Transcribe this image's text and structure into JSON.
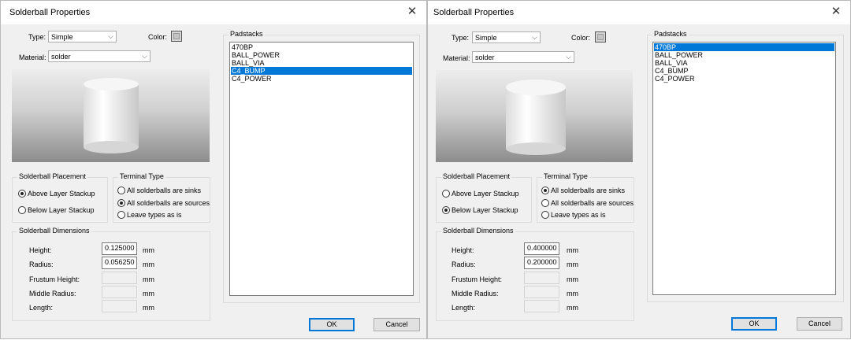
{
  "dialogs": [
    {
      "title": "Solderball Properties",
      "type_label": "Type:",
      "type_value": "Simple",
      "color_label": "Color:",
      "material_label": "Material:",
      "material_value": "solder",
      "placement": {
        "title": "Solderball Placement",
        "options": [
          "Above Layer Stackup",
          "Below Layer Stackup"
        ],
        "selected": 0
      },
      "terminal": {
        "title": "Terminal Type",
        "options": [
          "All solderballs are sinks",
          "All solderballs are sources",
          "Leave  types as is"
        ],
        "selected": 1
      },
      "dimensions": {
        "title": "Solderball Dimensions",
        "fields": [
          {
            "label": "Height:",
            "value": "0.125000",
            "unit": "mm",
            "enabled": true
          },
          {
            "label": "Radius:",
            "value": "0.056250",
            "unit": "mm",
            "enabled": true
          },
          {
            "label": "Frustum Height:",
            "value": "",
            "unit": "mm",
            "enabled": false
          },
          {
            "label": "Middle Radius:",
            "value": "",
            "unit": "mm",
            "enabled": false
          },
          {
            "label": "Length:",
            "value": "",
            "unit": "mm",
            "enabled": false
          }
        ]
      },
      "padstacks": {
        "title": "Padstacks",
        "items": [
          "470BP",
          "BALL_POWER",
          "BALL_VIA",
          "C4_BUMP",
          "C4_POWER"
        ],
        "selected": 3
      },
      "ok_label": "OK",
      "cancel_label": "Cancel"
    },
    {
      "title": "Solderball Properties",
      "type_label": "Type:",
      "type_value": "Simple",
      "color_label": "Color:",
      "material_label": "Material:",
      "material_value": "solder",
      "placement": {
        "title": "Solderball Placement",
        "options": [
          "Above Layer Stackup",
          "Below Layer Stackup"
        ],
        "selected": 1
      },
      "terminal": {
        "title": "Terminal Type",
        "options": [
          "All solderballs are sinks",
          "All solderballs are sources",
          "Leave  types as is"
        ],
        "selected": 0
      },
      "dimensions": {
        "title": "Solderball Dimensions",
        "fields": [
          {
            "label": "Height:",
            "value": "0.400000",
            "unit": "mm",
            "enabled": true
          },
          {
            "label": "Radius:",
            "value": "0.200000",
            "unit": "mm",
            "enabled": true
          },
          {
            "label": "Frustum Height:",
            "value": "",
            "unit": "mm",
            "enabled": false
          },
          {
            "label": "Middle Radius:",
            "value": "",
            "unit": "mm",
            "enabled": false
          },
          {
            "label": "Length:",
            "value": "",
            "unit": "mm",
            "enabled": false
          }
        ]
      },
      "padstacks": {
        "title": "Padstacks",
        "items": [
          "470BP",
          "BALL_POWER",
          "BALL_VIA",
          "C4_BUMP",
          "C4_POWER"
        ],
        "selected": 0
      },
      "ok_label": "OK",
      "cancel_label": "Cancel"
    }
  ],
  "icons": {
    "close": "close-icon",
    "dropdown": "chevron-down-icon"
  },
  "colors": {
    "selection": "#0078d7",
    "dialog_bg": "#f0f0f0"
  }
}
